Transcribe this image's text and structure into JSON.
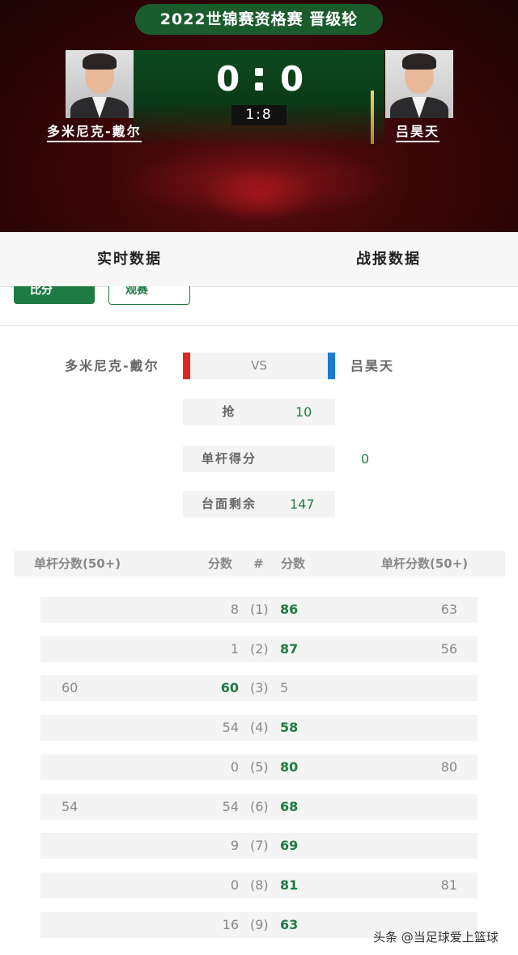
{
  "header": {
    "event_title": "2022世锦赛资格赛 晋级轮",
    "player_left": {
      "name": "多米尼克-戴尔",
      "score": "0"
    },
    "player_right": {
      "name": "吕昊天",
      "score": "0"
    },
    "frame_info": "1:8"
  },
  "tabs": [
    {
      "label": "实时数据"
    },
    {
      "label": "战报数据"
    }
  ],
  "peek_buttons": {
    "score_label": "比分",
    "watch_label": "观赛"
  },
  "vs_block": {
    "left_name": "多米尼克-戴尔",
    "vs_text": "VS",
    "right_name": "吕昊天",
    "colors": {
      "left": "#e0261c",
      "right": "#1a7bd6",
      "accent": "#1e7b43"
    },
    "stats": [
      {
        "label": "抢",
        "value": "10"
      },
      {
        "label": "单杆得分",
        "value": "0"
      },
      {
        "label": "台面剩余",
        "value": "147"
      }
    ]
  },
  "table": {
    "headers": {
      "left_break": "单杆分数(50+)",
      "left_score": "分数",
      "num": "#",
      "right_score": "分数",
      "right_break": "单杆分数(50+)"
    },
    "rows": [
      {
        "left_break": "",
        "left_score": "8",
        "num": "(1)",
        "right_score": "86",
        "right_break": "63",
        "winner": "right"
      },
      {
        "left_break": "",
        "left_score": "1",
        "num": "(2)",
        "right_score": "87",
        "right_break": "56",
        "winner": "right"
      },
      {
        "left_break": "60",
        "left_score": "60",
        "num": "(3)",
        "right_score": "5",
        "right_break": "",
        "winner": "left"
      },
      {
        "left_break": "",
        "left_score": "54",
        "num": "(4)",
        "right_score": "58",
        "right_break": "",
        "winner": "right"
      },
      {
        "left_break": "",
        "left_score": "0",
        "num": "(5)",
        "right_score": "80",
        "right_break": "80",
        "winner": "right"
      },
      {
        "left_break": "54",
        "left_score": "54",
        "num": "(6)",
        "right_score": "68",
        "right_break": "",
        "winner": "right"
      },
      {
        "left_break": "",
        "left_score": "9",
        "num": "(7)",
        "right_score": "69",
        "right_break": "",
        "winner": "right"
      },
      {
        "left_break": "",
        "left_score": "0",
        "num": "(8)",
        "right_score": "81",
        "right_break": "81",
        "winner": "right"
      },
      {
        "left_break": "",
        "left_score": "16",
        "num": "(9)",
        "right_score": "63",
        "right_break": "",
        "winner": "right"
      }
    ]
  },
  "watermark": "头条 @当足球爱上篮球"
}
